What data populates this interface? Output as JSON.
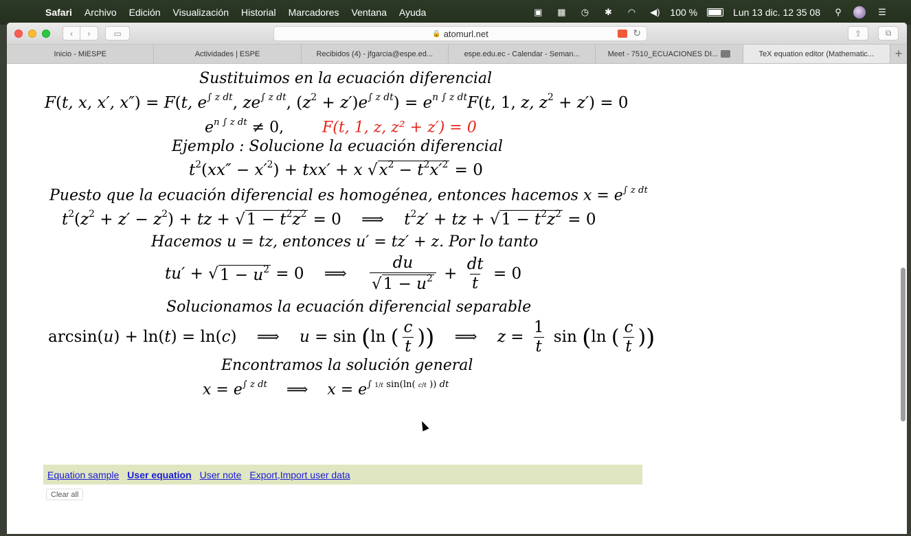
{
  "menubar": {
    "app": "Safari",
    "items": [
      "Archivo",
      "Edición",
      "Visualización",
      "Historial",
      "Marcadores",
      "Ventana",
      "Ayuda"
    ],
    "battery": "100 %",
    "datetime": "Lun 13 dic.  12 35 08"
  },
  "browser": {
    "url": "atomurl.net",
    "tabs": [
      "Inicio - MiESPE",
      "Actividades | ESPE",
      "Recibidos (4) - jfgarcia@espe.ed...",
      "espe.edu.ec - Calendar - Seman...",
      "Meet - 7510_ECUACIONES DI...",
      "TeX equation editor (Mathematic..."
    ],
    "active_tab": 5
  },
  "equations": {
    "l1": "Sustituimos en la ecuación diferencial",
    "l3_red": "F(t, 1, z, z² + z′) = 0",
    "l4": "Ejemplo :     Solucione la ecuación diferencial",
    "l6": "Puesto que la ecuación diferencial es homogénea, entonces hacemos x = e",
    "l8": "Hacemos u = tz, entonces u′ = tz′ + z. Por lo tanto",
    "l10": "Solucionamos la ecuación diferencial separable",
    "l12": "Encontramos la solución general"
  },
  "links": {
    "equation_sample": "Equation sample",
    "user_equation": "User equation",
    "user_note": "User note",
    "export_import": "Export,Import user data",
    "clear_all": "Clear all"
  },
  "colors": {
    "accent_red": "#e5231b",
    "link_blue": "#1a1adb",
    "link_bar_bg": "#dfe6c0"
  }
}
